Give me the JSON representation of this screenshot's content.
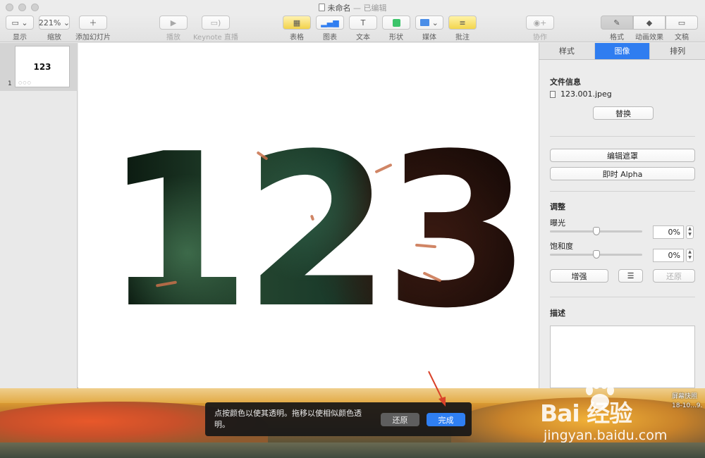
{
  "window": {
    "title": "未命名",
    "title_status": "— 已编辑"
  },
  "toolbar": {
    "view_label": "显示",
    "zoom_value": "221%",
    "zoom_label": "缩放",
    "add_slide_label": "添加幻灯片",
    "play_label": "播放",
    "keynote_live_label": "Keynote 直播",
    "table_label": "表格",
    "chart_label": "图表",
    "text_label": "文本",
    "shape_label": "形状",
    "media_label": "媒体",
    "comment_label": "批注",
    "collaborate_label": "协作",
    "format_label": "格式",
    "animate_label": "动画效果",
    "document_label": "文稿"
  },
  "navigator": {
    "slide_number": "1",
    "slide_thumb_text": "123"
  },
  "canvas": {
    "slide_text": "123"
  },
  "inspector": {
    "tabs": [
      "样式",
      "图像",
      "排列"
    ],
    "active_tab": "图像",
    "file_info_title": "文件信息",
    "file_name": "123.001.jpeg",
    "replace_label": "替换",
    "edit_mask_label": "编辑遮罩",
    "instant_alpha_label": "即时 Alpha",
    "adjust_title": "调整",
    "exposure_label": "曝光",
    "exposure_value": "0%",
    "exposure_level": 0.5,
    "saturation_label": "饱和度",
    "saturation_value": "0%",
    "saturation_level": 0.5,
    "enhance_label": "增强",
    "revert_label": "还原",
    "description_title": "描述"
  },
  "instant_alpha_hud": {
    "instruction": "点按颜色以使其透明。拖移以使相似颜色透明。",
    "revert_label": "还原",
    "done_label": "完成"
  },
  "desktop": {
    "screenshot_label": "屏幕快照",
    "screenshot_date": "18-10...9.",
    "watermark_brand": "Bai  经验",
    "watermark_url": "jingyan.baidu.com"
  },
  "colors": {
    "accent": "#2f7df0",
    "hud_background": "#181818",
    "arrow": "#d9422a"
  }
}
